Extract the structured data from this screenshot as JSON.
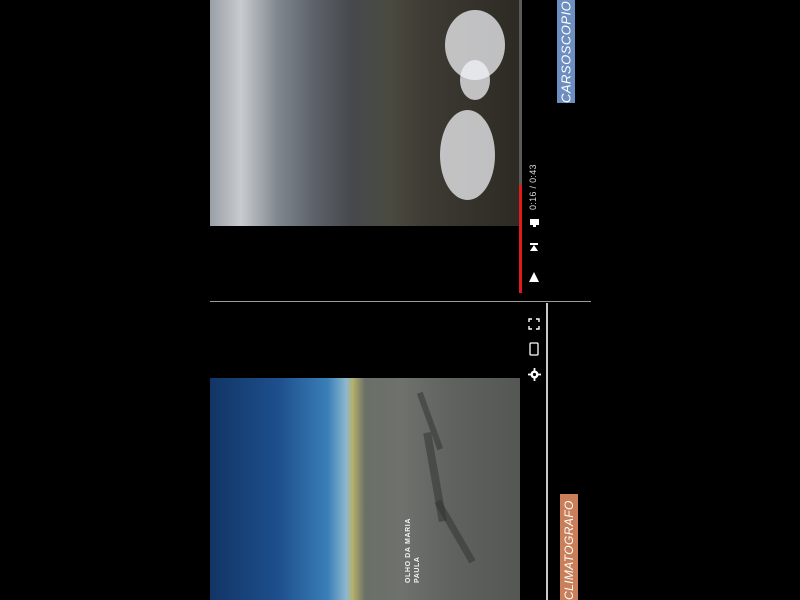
{
  "top_video": {
    "label": "CARSOSCOPIO",
    "time_display": "0:16 / 0:43",
    "progress": 0.37,
    "icons": {
      "play": "play-icon",
      "next": "skip-next-icon",
      "volume": "volume-icon"
    }
  },
  "bottom_video": {
    "label": "CLIMATOGRAFO",
    "map_label_line1": "OLHO DA",
    "map_label_line2": "MARIA PAULA",
    "icons": {
      "fullscreen": "fullscreen-icon",
      "miniplayer": "miniplayer-icon",
      "settings": "settings-icon"
    }
  },
  "colors": {
    "progress": "#e01b1b",
    "label_top": "#6d8ec1",
    "label_bottom": "#c9805a"
  }
}
